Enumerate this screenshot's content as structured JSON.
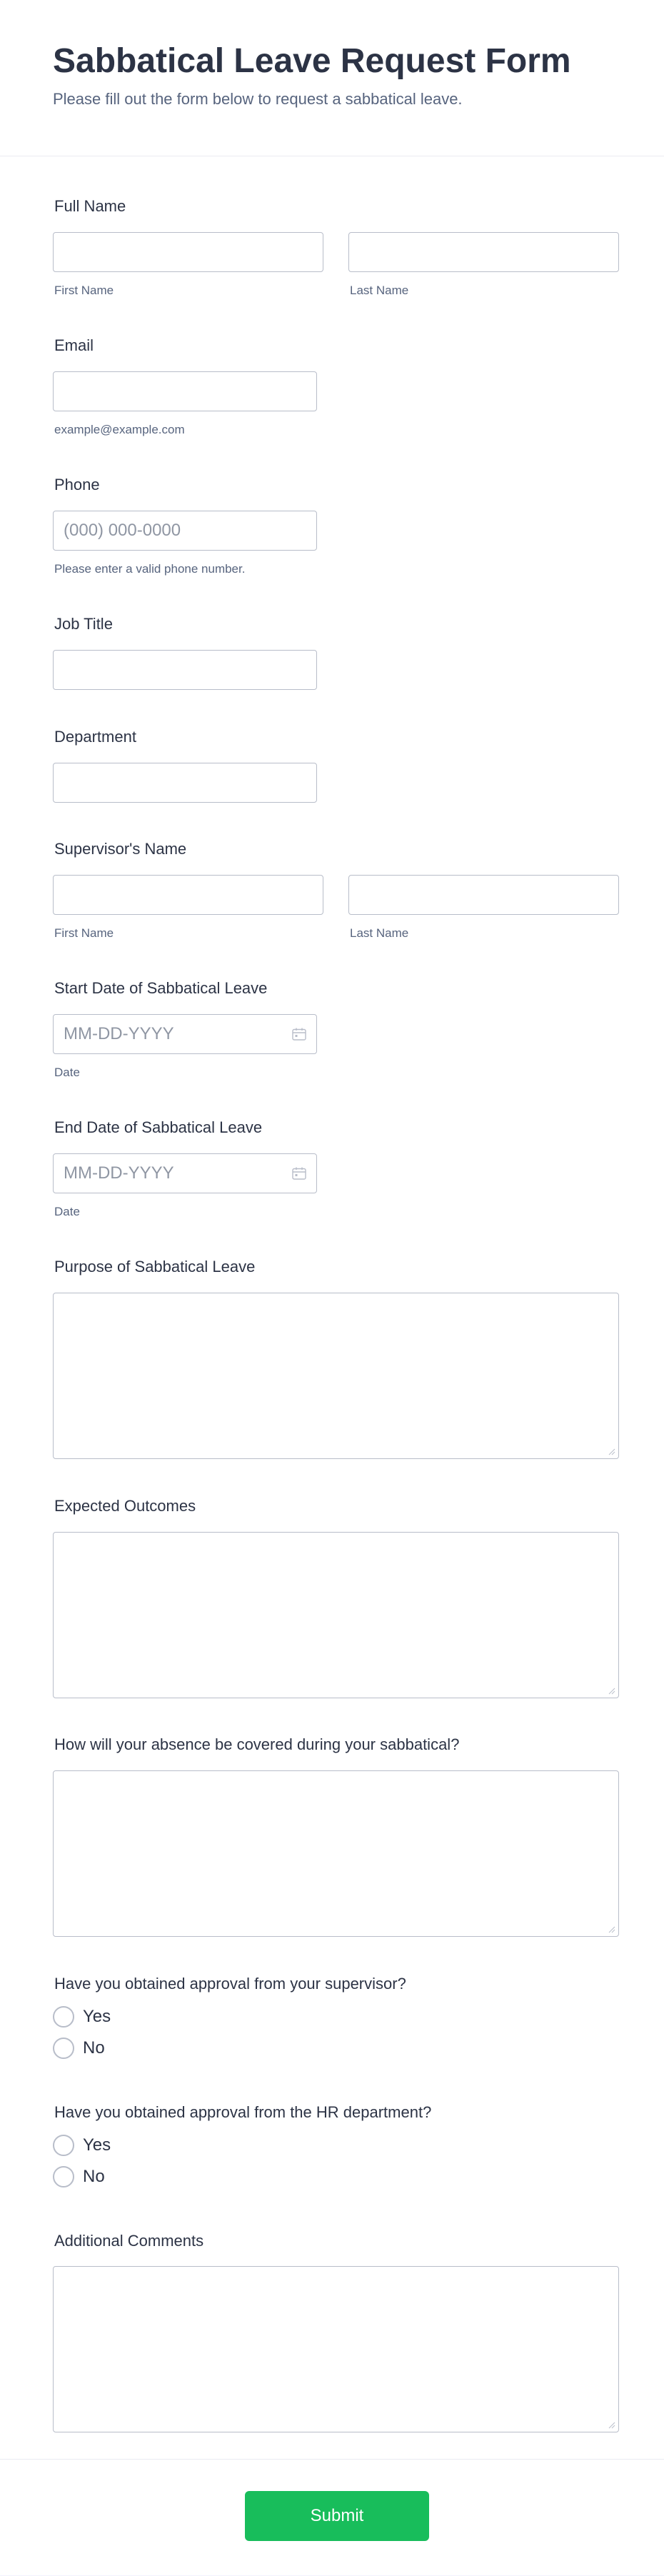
{
  "form": {
    "title": "Sabbatical Leave Request Form",
    "subtitle": "Please fill out the form below to request a sabbatical leave."
  },
  "fields": {
    "full_name": {
      "label": "Full Name",
      "first_sub": "First Name",
      "last_sub": "Last Name"
    },
    "email": {
      "label": "Email",
      "sub": "example@example.com"
    },
    "phone": {
      "label": "Phone",
      "placeholder": "(000) 000-0000",
      "sub": "Please enter a valid phone number."
    },
    "job_title": {
      "label": "Job Title"
    },
    "department": {
      "label": "Department"
    },
    "supervisor": {
      "label": "Supervisor's Name",
      "first_sub": "First Name",
      "last_sub": "Last Name"
    },
    "start_date": {
      "label": "Start Date of Sabbatical Leave",
      "placeholder": "MM-DD-YYYY",
      "sub": "Date"
    },
    "end_date": {
      "label": "End Date of Sabbatical Leave",
      "placeholder": "MM-DD-YYYY",
      "sub": "Date"
    },
    "purpose": {
      "label": "Purpose of Sabbatical Leave"
    },
    "outcomes": {
      "label": "Expected Outcomes"
    },
    "coverage": {
      "label": "How will your absence be covered during your sabbatical?"
    },
    "supervisor_approval": {
      "label": "Have you obtained approval from your supervisor?",
      "options": [
        "Yes",
        "No"
      ]
    },
    "hr_approval": {
      "label": "Have you obtained approval from the HR department?",
      "options": [
        "Yes",
        "No"
      ]
    },
    "comments": {
      "label": "Additional Comments"
    }
  },
  "submit_label": "Submit",
  "colors": {
    "accent": "#18bd5b",
    "text": "#2c3345",
    "subtext": "#57647e",
    "border": "#b8bdc9"
  },
  "icons": {
    "date": "calendar-icon",
    "textarea_corner": "resize-handle-icon"
  }
}
